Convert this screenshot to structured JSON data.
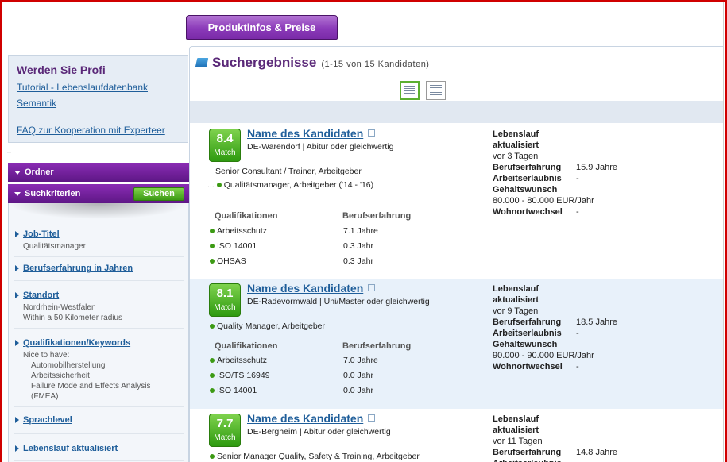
{
  "top_tab": {
    "label": "Produktinfos & Preise"
  },
  "profi_box": {
    "title": "Werden Sie Profi",
    "links": [
      "Tutorial - Lebenslaufdatenbank",
      "Semantik",
      "FAQ zur Kooperation mit Experteer"
    ]
  },
  "sidebar": {
    "dash": "–",
    "folder_label": "Ordner",
    "criteria_label": "Suchkriterien",
    "search_button": "Suchen",
    "criteria": [
      {
        "title": "Job-Titel",
        "lines": [
          "Qualitätsmanager"
        ]
      },
      {
        "title": "Berufserfahrung in Jahren",
        "lines": []
      },
      {
        "title": "Standort",
        "lines": [
          "Nordrhein-Westfalen",
          "Within a 50 Kilometer radius"
        ]
      },
      {
        "title": "Qualifikationen/Keywords",
        "lines": [
          "Nice to have:"
        ],
        "indented": [
          "Automobilherstellung",
          "Arbeitssicherheit",
          "Failure Mode and Effects Analysis",
          "(FMEA)"
        ]
      },
      {
        "title": "Sprachlevel",
        "lines": []
      },
      {
        "title": "Lebenslauf aktualisiert",
        "lines": []
      }
    ]
  },
  "results": {
    "title": "Suchergebnisse",
    "count": "(1-15 von 15 Kandidaten)",
    "labels": {
      "qual_header": "Qualifikationen",
      "exp_header": "Berufserfahrung",
      "cv_updated": "Lebenslauf aktualisiert",
      "experience": "Berufserfahrung",
      "permit": "Arbeitserlaubnis",
      "salary": "Gehaltswunsch",
      "relocation": "Wohnortwechsel"
    },
    "candidates": [
      {
        "score": "8.4",
        "match": "Match",
        "name": "Name des Kandidaten",
        "location": "DE-Warendorf | Abitur oder gleichwertig",
        "jobs": [
          "Senior Consultant / Trainer, Arbeitgeber",
          "Qualitätsmanager, Arbeitgeber ('14 - '16)"
        ],
        "ellipsis": "...",
        "quals": [
          [
            "Arbeitsschutz",
            "7.1 Jahre"
          ],
          [
            "ISO 14001",
            "0.3 Jahr"
          ],
          [
            "OHSAS",
            "0.3 Jahr"
          ]
        ],
        "updated": "vor 3 Tagen",
        "experience": "15.9 Jahre",
        "permit": "-",
        "salary": "80.000 - 80.000 EUR/Jahr",
        "relocation": "-"
      },
      {
        "score": "8.1",
        "match": "Match",
        "name": "Name des Kandidaten",
        "location": "DE-Radevormwald | Uni/Master oder gleichwertig",
        "jobs": [
          "Quality Manager, Arbeitgeber"
        ],
        "quals": [
          [
            "Arbeitsschutz",
            "7.0 Jahre"
          ],
          [
            "ISO/TS 16949",
            "0.0 Jahr"
          ],
          [
            "ISO 14001",
            "0.0 Jahr"
          ]
        ],
        "updated": "vor 9 Tagen",
        "experience": "18.5 Jahre",
        "permit": "-",
        "salary": "90.000 - 90.000 EUR/Jahr",
        "relocation": "-"
      },
      {
        "score": "7.7",
        "match": "Match",
        "name": "Name des Kandidaten",
        "location": "DE-Bergheim | Abitur oder gleichwertig",
        "jobs": [
          "Senior Manager Quality, Safety & Training, Arbeitgeber"
        ],
        "updated": "vor 11 Tagen",
        "experience": "14.8 Jahre"
      }
    ]
  }
}
